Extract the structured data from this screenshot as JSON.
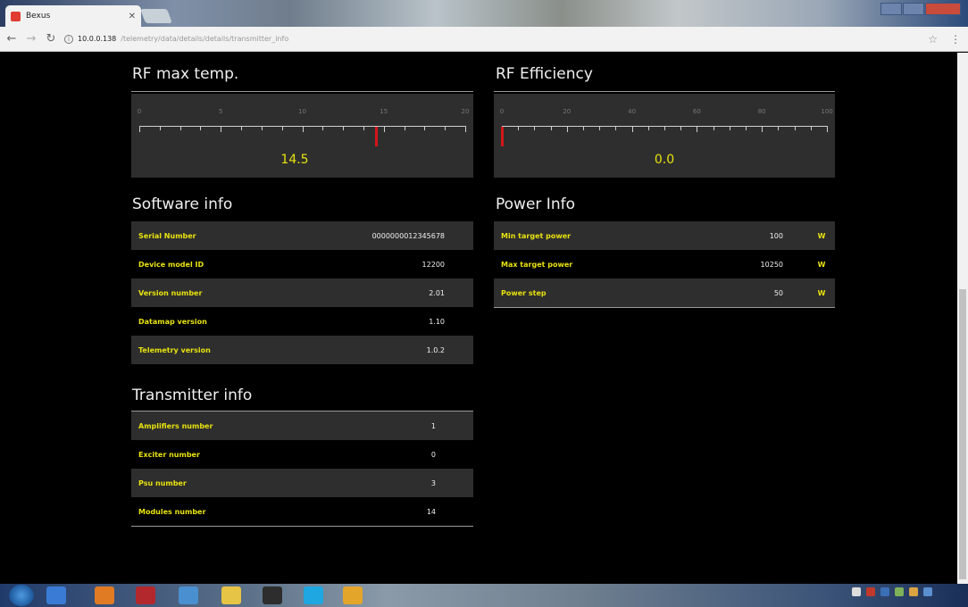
{
  "browser": {
    "tab_title": "Bexus",
    "url_host": "10.0.0.138",
    "url_path": "/telemetry/data/details/details/transmitter_info"
  },
  "rf_max_temp": {
    "title": "RF max temp.",
    "scale_labels": [
      "0",
      "5",
      "10",
      "15",
      "20"
    ],
    "value": 14.5,
    "readout": "14.5"
  },
  "rf_efficiency": {
    "title": "RF Efficiency",
    "scale_labels": [
      "0",
      "20",
      "40",
      "60",
      "80",
      "100"
    ],
    "value": 0.0,
    "readout": "0.0"
  },
  "software_info": {
    "title": "Software info",
    "rows": [
      {
        "label": "Serial Number",
        "value": "0000000012345678"
      },
      {
        "label": "Device model ID",
        "value": "12200"
      },
      {
        "label": "Version number",
        "value": "2.01"
      },
      {
        "label": "Datamap version",
        "value": "1.10"
      },
      {
        "label": "Telemetry version",
        "value": "1.0.2"
      }
    ]
  },
  "power_info": {
    "title": "Power Info",
    "rows": [
      {
        "label": "Min target power",
        "value": "100",
        "unit": "W"
      },
      {
        "label": "Max target power",
        "value": "10250",
        "unit": "W"
      },
      {
        "label": "Power step",
        "value": "50",
        "unit": "W"
      }
    ]
  },
  "transmitter_info": {
    "title": "Transmitter info",
    "rows": [
      {
        "label": "Amplifiers number",
        "value": "1"
      },
      {
        "label": "Exciter number",
        "value": "0"
      },
      {
        "label": "Psu number",
        "value": "3"
      },
      {
        "label": "Modules number",
        "value": "14"
      }
    ]
  },
  "colors": {
    "accent_yellow": "#e7e20f",
    "needle_red": "#d4161a",
    "panel_bg": "#2e2e2e",
    "page_bg": "#000000"
  },
  "icons": [
    "back-icon",
    "forward-icon",
    "reload-icon",
    "info-icon",
    "star-icon",
    "menu-icon"
  ]
}
